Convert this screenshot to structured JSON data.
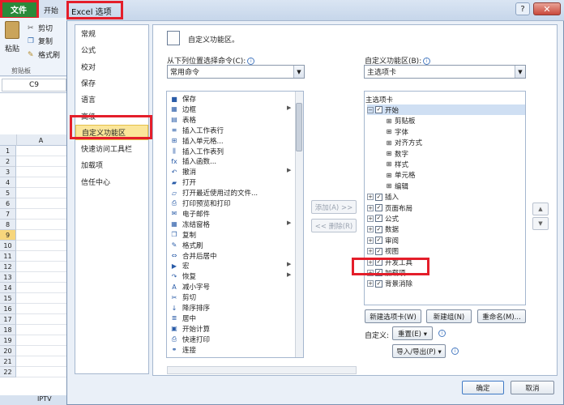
{
  "background": {
    "file_tab": "文件",
    "home_tab": "开始",
    "ribbon": {
      "paste": "粘贴",
      "cut": "剪切",
      "copy": "复制",
      "format_painter": "格式刷",
      "group": "剪贴板"
    },
    "name_box": "C9",
    "column_a": "A",
    "rows": [
      "1",
      "2",
      "3",
      "4",
      "5",
      "6",
      "7",
      "8",
      "9",
      "10",
      "11",
      "12",
      "13",
      "14",
      "15",
      "16",
      "17",
      "18",
      "19",
      "20",
      "21",
      "22"
    ],
    "selected_row": "9",
    "sheet_tab": "IPTV"
  },
  "dialog": {
    "title": "Excel 选项",
    "help": "?",
    "close": "✕",
    "nav": [
      "常规",
      "公式",
      "校对",
      "保存",
      "语言",
      "高级",
      "自定义功能区",
      "快速访问工具栏",
      "加载项",
      "信任中心"
    ],
    "nav_active": "自定义功能区",
    "header": "自定义功能区。",
    "left_label": "从下列位置选择命令(C):",
    "left_combo": "常用命令",
    "right_label": "自定义功能区(B):",
    "right_combo": "主选项卡",
    "commands": [
      {
        "icon": "save-icon",
        "glyph": "■",
        "label": "保存",
        "arrow": false
      },
      {
        "icon": "border-icon",
        "glyph": "▦",
        "label": "边框",
        "arrow": true
      },
      {
        "icon": "table-icon",
        "glyph": "▤",
        "label": "表格",
        "arrow": false
      },
      {
        "icon": "insert-row-icon",
        "glyph": "≡",
        "label": "插入工作表行",
        "arrow": false
      },
      {
        "icon": "insert-cell-icon",
        "glyph": "⊞",
        "label": "插入单元格...",
        "arrow": false
      },
      {
        "icon": "insert-column-icon",
        "glyph": "⫼",
        "label": "插入工作表列",
        "arrow": false
      },
      {
        "icon": "function-icon",
        "glyph": "fx",
        "label": "插入函数...",
        "arrow": false
      },
      {
        "icon": "undo-icon",
        "glyph": "↶",
        "label": "撤消",
        "arrow": true
      },
      {
        "icon": "open-icon",
        "glyph": "▰",
        "label": "打开",
        "arrow": false
      },
      {
        "icon": "recent-file-icon",
        "glyph": "▱",
        "label": "打开最近使用过的文件...",
        "arrow": false
      },
      {
        "icon": "print-preview-icon",
        "glyph": "⎙",
        "label": "打印预览和打印",
        "arrow": false
      },
      {
        "icon": "email-icon",
        "glyph": "✉",
        "label": "电子邮件",
        "arrow": false
      },
      {
        "icon": "freeze-panes-icon",
        "glyph": "▦",
        "label": "冻结窗格",
        "arrow": true
      },
      {
        "icon": "copy-icon",
        "glyph": "❐",
        "label": "复制",
        "arrow": false
      },
      {
        "icon": "format-painter-icon",
        "glyph": "✎",
        "label": "格式刷",
        "arrow": false
      },
      {
        "icon": "merge-center-icon",
        "glyph": "⇔",
        "label": "合并后居中",
        "arrow": false
      },
      {
        "icon": "macro-icon",
        "glyph": "▶",
        "label": "宏",
        "arrow": true
      },
      {
        "icon": "redo-icon",
        "glyph": "↷",
        "label": "恢复",
        "arrow": true
      },
      {
        "icon": "decrease-font-icon",
        "glyph": "A",
        "label": "减小字号",
        "arrow": false
      },
      {
        "icon": "cut-icon",
        "glyph": "✂",
        "label": "剪切",
        "arrow": false
      },
      {
        "icon": "sort-desc-icon",
        "glyph": "↓",
        "label": "降序排序",
        "arrow": false
      },
      {
        "icon": "center-icon",
        "glyph": "≣",
        "label": "居中",
        "arrow": false
      },
      {
        "icon": "calculate-icon",
        "glyph": "▣",
        "label": "开始计算",
        "arrow": false
      },
      {
        "icon": "quick-print-icon",
        "glyph": "⎙",
        "label": "快速打印",
        "arrow": false
      },
      {
        "icon": "link-icon",
        "glyph": "⚭",
        "label": "连接",
        "arrow": false
      }
    ],
    "add_button": "添加(A) >>",
    "remove_button": "<< 删除(R)",
    "tree": [
      {
        "type": "header",
        "label": "主选项卡"
      },
      {
        "type": "tab",
        "label": "开始",
        "expanded": true,
        "checked": true,
        "selected": true
      },
      {
        "type": "group",
        "label": "剪贴板"
      },
      {
        "type": "group",
        "label": "字体"
      },
      {
        "type": "group",
        "label": "对齐方式"
      },
      {
        "type": "group",
        "label": "数字"
      },
      {
        "type": "group",
        "label": "样式"
      },
      {
        "type": "group",
        "label": "单元格"
      },
      {
        "type": "group",
        "label": "编辑"
      },
      {
        "type": "tab",
        "label": "插入",
        "expanded": false,
        "checked": true
      },
      {
        "type": "tab",
        "label": "页面布局",
        "expanded": false,
        "checked": true
      },
      {
        "type": "tab",
        "label": "公式",
        "expanded": false,
        "checked": true
      },
      {
        "type": "tab",
        "label": "数据",
        "expanded": false,
        "checked": true
      },
      {
        "type": "tab",
        "label": "审阅",
        "expanded": false,
        "checked": true
      },
      {
        "type": "tab",
        "label": "视图",
        "expanded": false,
        "checked": true
      },
      {
        "type": "tab",
        "label": "开发工具",
        "expanded": false,
        "checked": true
      },
      {
        "type": "tab",
        "label": "加载项",
        "expanded": false,
        "checked": true
      },
      {
        "type": "tab",
        "label": "背景消除",
        "expanded": false,
        "checked": true
      }
    ],
    "new_tab_button": "新建选项卡(W)",
    "new_group_button": "新建组(N)",
    "rename_button": "重命名(M)...",
    "customize_label": "自定义:",
    "reset_button": "重置(E) ▾",
    "import_export_button": "导入/导出(P) ▾",
    "ok_button": "确定",
    "cancel_button": "取消"
  },
  "accent_colors": {
    "highlight_red": "#e41e2a",
    "file_green": "#2a8a3a",
    "nav_active": "#fbe69a"
  }
}
